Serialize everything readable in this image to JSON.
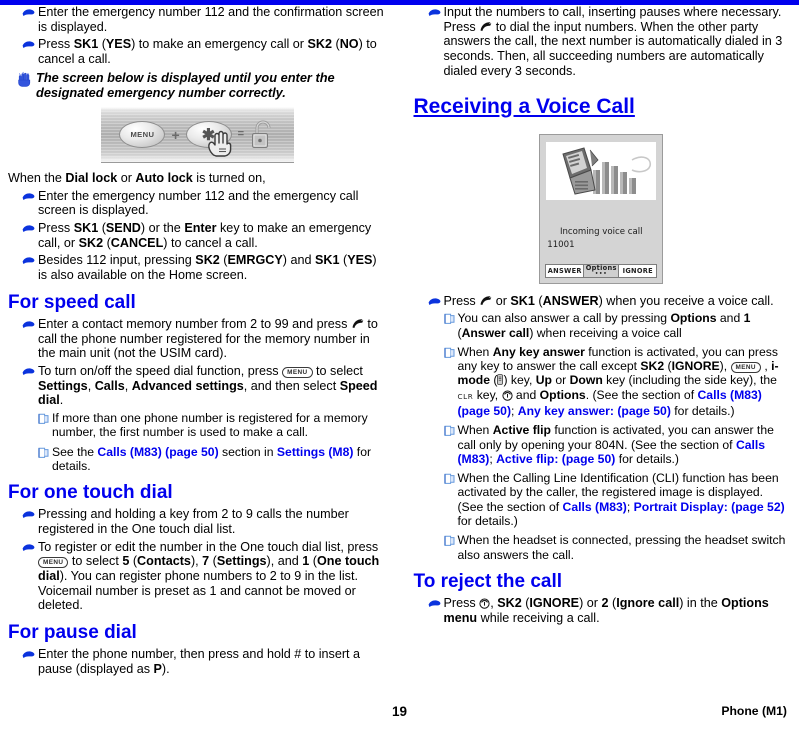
{
  "document": {
    "page_number": "19",
    "footer_right": "Phone (M1)",
    "accent_color": "#0000ee"
  },
  "left_column": {
    "bullets_top": [
      {
        "id": "emergency-confirm",
        "parts": [
          {
            "t": "Enter the emergency number 112 and the confirmation screen is displayed.",
            "s": "n"
          }
        ]
      },
      {
        "id": "emergency-sk1-sk2",
        "parts": [
          {
            "t": "Press ",
            "s": "n"
          },
          {
            "t": "SK1",
            "s": "b"
          },
          {
            "t": " (",
            "s": "n"
          },
          {
            "t": "YES",
            "s": "b"
          },
          {
            "t": ") to make an emergency call or ",
            "s": "n"
          },
          {
            "t": "SK2",
            "s": "b"
          },
          {
            "t": " (",
            "s": "n"
          },
          {
            "t": "NO",
            "s": "b"
          },
          {
            "t": ") to cancel a call.",
            "s": "n"
          }
        ]
      }
    ],
    "hand_note": "The screen below is displayed until you enter the designated emergency number correctly.",
    "figure_lock": {
      "menu_key_label": "MENU",
      "star_key_label": "✱",
      "plus_symbol": "+",
      "equals_symbol": "=",
      "result": "unlocked-padlock"
    },
    "lead_dial_lock": {
      "parts": [
        {
          "t": "When the ",
          "s": "n"
        },
        {
          "t": "Dial lock",
          "s": "b"
        },
        {
          "t": " or ",
          "s": "n"
        },
        {
          "t": "Auto lock",
          "s": "b"
        },
        {
          "t": " is turned on,",
          "s": "n"
        }
      ]
    },
    "bullets_lock": [
      {
        "id": "emergency-call-screen",
        "parts": [
          {
            "t": "Enter the emergency number 112 and the emergency call screen is displayed.",
            "s": "n"
          }
        ]
      },
      {
        "id": "press-send-enter",
        "parts": [
          {
            "t": "Press ",
            "s": "n"
          },
          {
            "t": "SK1",
            "s": "b"
          },
          {
            "t": " (",
            "s": "n"
          },
          {
            "t": "SEND",
            "s": "b"
          },
          {
            "t": ") or the ",
            "s": "n"
          },
          {
            "t": "Enter",
            "s": "b"
          },
          {
            "t": " key to make an emergency call, or ",
            "s": "n"
          },
          {
            "t": "SK2",
            "s": "b"
          },
          {
            "t": " (",
            "s": "n"
          },
          {
            "t": "CANCEL",
            "s": "b"
          },
          {
            "t": ") to cancel a call.",
            "s": "n"
          }
        ]
      },
      {
        "id": "besides-112",
        "parts": [
          {
            "t": "Besides 112 input, pressing ",
            "s": "n"
          },
          {
            "t": "SK2",
            "s": "b"
          },
          {
            "t": " (",
            "s": "n"
          },
          {
            "t": "EMRGCY",
            "s": "b"
          },
          {
            "t": ") and ",
            "s": "n"
          },
          {
            "t": "SK1",
            "s": "b"
          },
          {
            "t": " (",
            "s": "n"
          },
          {
            "t": "YES",
            "s": "b"
          },
          {
            "t": ") is also available on the Home screen.",
            "s": "n"
          }
        ]
      }
    ],
    "heading_speed_call": "For speed call",
    "bullets_speed": [
      {
        "id": "contact-memory-number",
        "parts": [
          {
            "t": "Enter a contact memory number from 2 to 99 and press ",
            "s": "n"
          },
          {
            "t": "",
            "s": "send-glyph"
          },
          {
            "t": " to call the phone number registered for the memory number in the main unit (not the USIM card).",
            "s": "n"
          }
        ]
      },
      {
        "id": "toggle-speed-dial",
        "parts": [
          {
            "t": "To turn on/off the speed dial function, press ",
            "s": "n"
          },
          {
            "t": "MENU",
            "s": "menu-key"
          },
          {
            "t": "  to select ",
            "s": "n"
          },
          {
            "t": "Settings",
            "s": "b"
          },
          {
            "t": ", ",
            "s": "n"
          },
          {
            "t": "Calls",
            "s": "b"
          },
          {
            "t": ", ",
            "s": "n"
          },
          {
            "t": "Advanced settings",
            "s": "b"
          },
          {
            "t": ", and then select ",
            "s": "n"
          },
          {
            "t": "Speed dial",
            "s": "b"
          },
          {
            "t": ".",
            "s": "n"
          }
        ]
      }
    ],
    "notes_speed": [
      {
        "id": "more-than-one-number",
        "parts": [
          {
            "t": "If more than one phone number is registered for a memory number, the first number is used to make a call.",
            "s": "n"
          }
        ]
      },
      {
        "id": "see-calls-m83",
        "parts": [
          {
            "t": "See the ",
            "s": "n"
          },
          {
            "t": "Calls (M83) (page 50)",
            "s": "link"
          },
          {
            "t": " section in ",
            "s": "n"
          },
          {
            "t": "Settings (M8)",
            "s": "link"
          },
          {
            "t": " for details.",
            "s": "n"
          }
        ]
      }
    ],
    "heading_one_touch": "For one touch dial",
    "bullets_one_touch": [
      {
        "id": "press-hold-key",
        "parts": [
          {
            "t": "Pressing and holding a key from 2 to 9 calls the number registered in the One touch dial list.",
            "s": "n"
          }
        ]
      },
      {
        "id": "register-edit-one-touch",
        "parts": [
          {
            "t": "To register or edit the number in the One touch dial list, press ",
            "s": "n"
          },
          {
            "t": "MENU",
            "s": "menu-key"
          },
          {
            "t": " to select ",
            "s": "n"
          },
          {
            "t": "5",
            "s": "b"
          },
          {
            "t": " (",
            "s": "n"
          },
          {
            "t": "Contacts",
            "s": "b"
          },
          {
            "t": "), ",
            "s": "n"
          },
          {
            "t": "7",
            "s": "b"
          },
          {
            "t": " (",
            "s": "n"
          },
          {
            "t": "Settings",
            "s": "b"
          },
          {
            "t": "), and ",
            "s": "n"
          },
          {
            "t": "1",
            "s": "b"
          },
          {
            "t": " (",
            "s": "n"
          },
          {
            "t": "One touch dial",
            "s": "b"
          },
          {
            "t": "). You can register phone numbers to 2 to 9 in the list. Voicemail number is preset as 1 and cannot be moved or deleted.",
            "s": "n"
          }
        ]
      }
    ],
    "heading_pause_dial": "For pause dial",
    "bullets_pause": [
      {
        "id": "insert-pause",
        "parts": [
          {
            "t": "Enter the phone number, then press and hold # to insert a pause (displayed as ",
            "s": "n"
          },
          {
            "t": "P",
            "s": "b"
          },
          {
            "t": ").",
            "s": "n"
          }
        ]
      }
    ]
  },
  "right_column": {
    "bullets_top": [
      {
        "id": "input-numbers-pauses",
        "parts": [
          {
            "t": "Input the numbers to call, inserting pauses where necessary. Press ",
            "s": "n"
          },
          {
            "t": "",
            "s": "send-glyph"
          },
          {
            "t": " to dial the input numbers. When the other party answers the call, the next number is automatically dialed in 3 seconds. Then, all succeeding numbers are automatically dialed every 3 seconds.",
            "s": "n"
          }
        ]
      }
    ],
    "heading_receiving": "Receiving a Voice Call",
    "figure_phone": {
      "status_text": "Incoming voice call",
      "number": "11001",
      "softkeys": {
        "left": "ANSWER",
        "middle": "Options",
        "middle_dots": "•••",
        "right": "IGNORE"
      }
    },
    "bullets_receive": [
      {
        "id": "press-answer",
        "parts": [
          {
            "t": "Press ",
            "s": "n"
          },
          {
            "t": "",
            "s": "send-glyph"
          },
          {
            "t": " or ",
            "s": "n"
          },
          {
            "t": "SK1",
            "s": "b"
          },
          {
            "t": " (",
            "s": "n"
          },
          {
            "t": "ANSWER",
            "s": "b"
          },
          {
            "t": ") when you receive a voice call.",
            "s": "n"
          }
        ]
      }
    ],
    "notes_receive": [
      {
        "id": "answer-via-options",
        "parts": [
          {
            "t": "You can also answer a call by pressing ",
            "s": "n"
          },
          {
            "t": "Options",
            "s": "b"
          },
          {
            "t": " and ",
            "s": "n"
          },
          {
            "t": "1",
            "s": "b"
          },
          {
            "t": " (",
            "s": "n"
          },
          {
            "t": "Answer call",
            "s": "b"
          },
          {
            "t": ") when receiving a voice call",
            "s": "n"
          }
        ]
      },
      {
        "id": "any-key-answer",
        "parts": [
          {
            "t": "When ",
            "s": "n"
          },
          {
            "t": "Any key answer",
            "s": "b"
          },
          {
            "t": " function is activated, you can press any key to answer the call except ",
            "s": "n"
          },
          {
            "t": "SK2",
            "s": "b"
          },
          {
            "t": " (",
            "s": "n"
          },
          {
            "t": "IGNORE",
            "s": "b"
          },
          {
            "t": "), ",
            "s": "n"
          },
          {
            "t": "MENU",
            "s": "menu-key"
          },
          {
            "t": " , ",
            "s": "n"
          },
          {
            "t": "i-mode",
            "s": "b"
          },
          {
            "t": " (",
            "s": "n"
          },
          {
            "t": "",
            "s": "imode-glyph"
          },
          {
            "t": ") key, ",
            "s": "n"
          },
          {
            "t": "Up",
            "s": "b"
          },
          {
            "t": " or ",
            "s": "n"
          },
          {
            "t": "Down",
            "s": "b"
          },
          {
            "t": " key (including the side key), the ",
            "s": "n"
          },
          {
            "t": "CLR",
            "s": "clr-key"
          },
          {
            "t": " key, ",
            "s": "n"
          },
          {
            "t": "",
            "s": "end-glyph"
          },
          {
            "t": " and ",
            "s": "n"
          },
          {
            "t": "Options",
            "s": "b"
          },
          {
            "t": ". (See the section of ",
            "s": "n"
          },
          {
            "t": "Calls (M83) (page 50)",
            "s": "link"
          },
          {
            "t": "; ",
            "s": "n"
          },
          {
            "t": "Any key answer: (page 50)",
            "s": "link"
          },
          {
            "t": " for details.)",
            "s": "n"
          }
        ]
      },
      {
        "id": "active-flip",
        "parts": [
          {
            "t": "When ",
            "s": "n"
          },
          {
            "t": "Active flip",
            "s": "b"
          },
          {
            "t": " function is activated, you can answer the call only by opening your 804N. (See the section of ",
            "s": "n"
          },
          {
            "t": "Calls (M83)",
            "s": "link"
          },
          {
            "t": "; ",
            "s": "n"
          },
          {
            "t": "Active flip: (page 50)",
            "s": "link"
          },
          {
            "t": " for details.)",
            "s": "n"
          }
        ]
      },
      {
        "id": "cli-portrait-display",
        "parts": [
          {
            "t": "When the Calling Line Identification (CLI) function has been activated by the caller, the registered image is displayed. (See the section of ",
            "s": "n"
          },
          {
            "t": "Calls (M83)",
            "s": "link"
          },
          {
            "t": "; ",
            "s": "n"
          },
          {
            "t": "Portrait Display: (page 52)",
            "s": "link"
          },
          {
            "t": " for details.)",
            "s": "n"
          }
        ]
      },
      {
        "id": "headset-switch",
        "parts": [
          {
            "t": "When the headset is connected, pressing the headset switch also answers the call.",
            "s": "n"
          }
        ]
      }
    ],
    "heading_reject": "To reject the call",
    "bullets_reject": [
      {
        "id": "press-ignore",
        "parts": [
          {
            "t": "Press ",
            "s": "n"
          },
          {
            "t": "",
            "s": "end-glyph"
          },
          {
            "t": ", ",
            "s": "n"
          },
          {
            "t": "SK2",
            "s": "b"
          },
          {
            "t": " (",
            "s": "n"
          },
          {
            "t": "IGNORE",
            "s": "b"
          },
          {
            "t": ") or ",
            "s": "n"
          },
          {
            "t": "2",
            "s": "b"
          },
          {
            "t": " (",
            "s": "n"
          },
          {
            "t": "Ignore call",
            "s": "b"
          },
          {
            "t": ") in the ",
            "s": "n"
          },
          {
            "t": "Options menu",
            "s": "b"
          },
          {
            "t": " while receiving a call.",
            "s": "n"
          }
        ]
      }
    ]
  }
}
